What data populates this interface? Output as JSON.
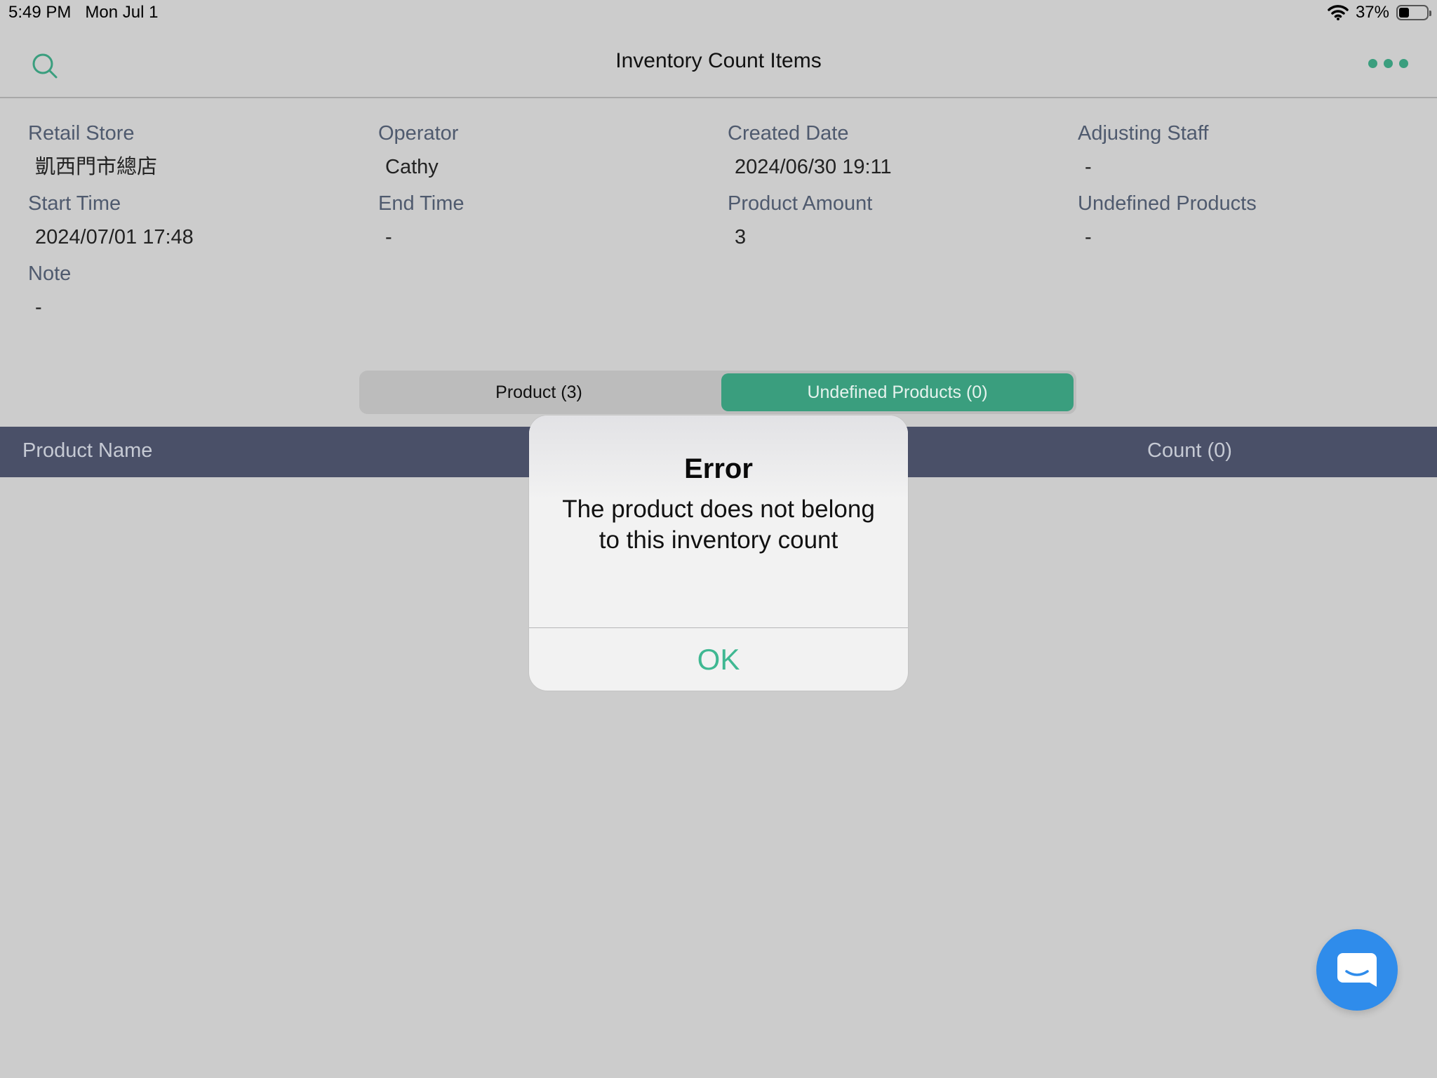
{
  "status_bar": {
    "time": "5:49 PM",
    "date": "Mon Jul 1",
    "battery_percent": "37%",
    "battery_level": 0.37,
    "icons": [
      "wifi-icon",
      "battery-icon"
    ]
  },
  "nav": {
    "title": "Inventory Count Items",
    "left_icon": "search-icon",
    "right_icon": "more-icon",
    "accent_color": "#3a9e7e"
  },
  "info": [
    {
      "label": "Retail Store",
      "value": "凱西門市總店"
    },
    {
      "label": "Operator",
      "value": "Cathy"
    },
    {
      "label": "Created Date",
      "value": "2024/06/30 19:11"
    },
    {
      "label": "Adjusting Staff",
      "value": "-"
    },
    {
      "label": "Start Time",
      "value": "2024/07/01 17:48"
    },
    {
      "label": "End Time",
      "value": "-"
    },
    {
      "label": "Product Amount",
      "value": "3"
    },
    {
      "label": "Undefined Products",
      "value": "-"
    },
    {
      "label": "Note",
      "value": "-"
    }
  ],
  "segments": {
    "product": "Product (3)",
    "undefined": "Undefined Products (0)",
    "selected": "undefined"
  },
  "table": {
    "columns": [
      "Product Name",
      "Count (0)"
    ],
    "header_color": "#4a5068"
  },
  "alert": {
    "title": "Error",
    "message": "The product does not belong to this inventory count",
    "ok_label": "OK",
    "ok_color": "#3fb892"
  },
  "chat_button": {
    "icon": "chat-icon",
    "color": "#2f8ceb"
  }
}
